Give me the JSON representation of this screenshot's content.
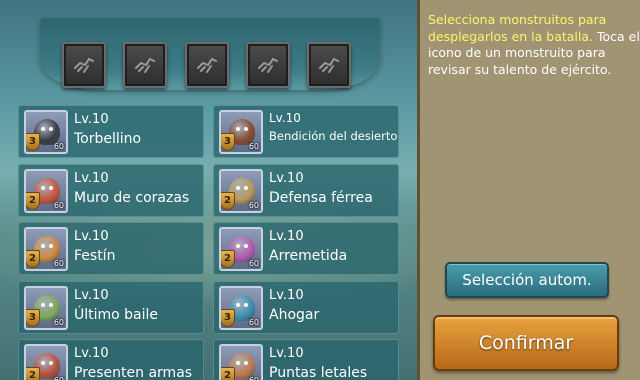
{
  "instructions": {
    "line_highlight": "Selecciona monstruitos para desplegarlos en la batalla.",
    "line_normal": "Toca el icono de un monstruito para revisar su talento de ejército."
  },
  "buttons": {
    "auto_select": "Selección autom.",
    "confirm": "Confirmar"
  },
  "slots": [
    {
      "icon": "empty-slot-icon"
    },
    {
      "icon": "empty-slot-icon"
    },
    {
      "icon": "empty-slot-icon"
    },
    {
      "icon": "empty-slot-icon"
    },
    {
      "icon": "empty-slot-icon"
    }
  ],
  "familiars": [
    {
      "level": "Lv.10",
      "skill": "Torbellino",
      "tier": "3",
      "power": "60",
      "color": "#3a3a46"
    },
    {
      "level": "Lv.10",
      "skill": "Bendición del desierto",
      "tier": "3",
      "power": "60",
      "color": "#8a4a2c"
    },
    {
      "level": "Lv.10",
      "skill": "Muro de corazas",
      "tier": "2",
      "power": "60",
      "color": "#c8563a"
    },
    {
      "level": "Lv.10",
      "skill": "Defensa férrea",
      "tier": "2",
      "power": "60",
      "color": "#b79a56"
    },
    {
      "level": "Lv.10",
      "skill": "Festín",
      "tier": "2",
      "power": "60",
      "color": "#d08a3c"
    },
    {
      "level": "Lv.10",
      "skill": "Arremetida",
      "tier": "2",
      "power": "60",
      "color": "#b65ab0"
    },
    {
      "level": "Lv.10",
      "skill": "Último baile",
      "tier": "3",
      "power": "60",
      "color": "#7da85a"
    },
    {
      "level": "Lv.10",
      "skill": "Ahogar",
      "tier": "3",
      "power": "60",
      "color": "#3c8fb3"
    },
    {
      "level": "Lv.10",
      "skill": "Presenten armas",
      "tier": "2",
      "power": "60",
      "color": "#b8503a"
    },
    {
      "level": "Lv.10",
      "skill": "Puntas letales",
      "tier": "2",
      "power": "60",
      "color": "#c07a4a"
    }
  ]
}
